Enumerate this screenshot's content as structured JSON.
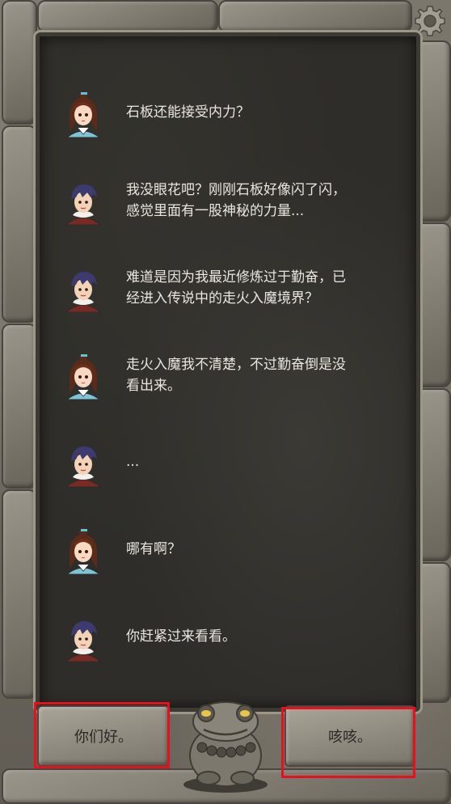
{
  "dialogue": [
    {
      "speaker": "girl",
      "text": "石板还能接受内力？"
    },
    {
      "speaker": "boy",
      "text": "我没眼花吧？刚刚石板好像闪了闪，\n感觉里面有一股神秘的力量..."
    },
    {
      "speaker": "boy",
      "text": "难道是因为我最近修炼过于勤奋，已\n经进入传说中的走火入魔境界？"
    },
    {
      "speaker": "girl",
      "text": "走火入魔我不清楚，不过勤奋倒是没\n看出来。"
    },
    {
      "speaker": "boy",
      "text": "..."
    },
    {
      "speaker": "girl",
      "text": "哪有啊？"
    },
    {
      "speaker": "boy",
      "text": "你赶紧过来看看。"
    }
  ],
  "choices": {
    "left_label": "你们好。",
    "right_label": "咳咳。"
  },
  "icons": {
    "settings": "gear-icon",
    "center_ornament": "toad-statue-icon"
  },
  "colors": {
    "highlight": "#e8101e",
    "panel": "#2e2d29",
    "text": "#e9e6df"
  }
}
